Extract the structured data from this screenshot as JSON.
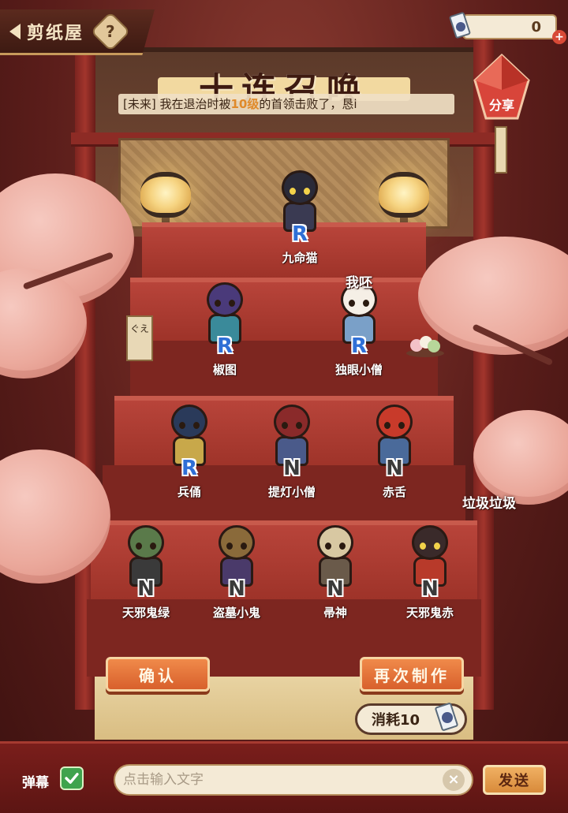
{
  "header": {
    "title": "剪纸屋",
    "help_symbol": "?",
    "currency_value": "0",
    "plus_symbol": "+"
  },
  "banner": {
    "title": "十连召唤"
  },
  "danmaku_message": {
    "prefix": "[未来] 我在退治时被",
    "highlight": "10级",
    "suffix": "的首领击败了，恳i"
  },
  "share": {
    "label": "分享"
  },
  "side_sign": "ぐえ",
  "characters": [
    {
      "name": "九命猫",
      "rarity": "R"
    },
    {
      "name": "椒图",
      "rarity": "R"
    },
    {
      "name": "独眼小僧",
      "rarity": "R"
    },
    {
      "name": "兵俑",
      "rarity": "R"
    },
    {
      "name": "提灯小僧",
      "rarity": "N"
    },
    {
      "name": "赤舌",
      "rarity": "N"
    },
    {
      "name": "天邪鬼绿",
      "rarity": "N"
    },
    {
      "name": "盗墓小鬼",
      "rarity": "N"
    },
    {
      "name": "帚神",
      "rarity": "N"
    },
    {
      "name": "天邪鬼赤",
      "rarity": "N"
    }
  ],
  "floating_comments": [
    "我呸",
    "垃圾垃圾"
  ],
  "actions": {
    "confirm_label": "确认",
    "again_label": "再次制作",
    "cost_label": "消耗10"
  },
  "bottom_bar": {
    "danmaku_label": "弹幕",
    "input_placeholder": "点击输入文字",
    "clear_symbol": "×",
    "send_label": "发送"
  },
  "colors": {
    "rarity_R": "#2f6fd6",
    "rarity_N": "#3a3a3a",
    "button_orange": "#e0703a",
    "background_red": "#6e1f1c"
  }
}
